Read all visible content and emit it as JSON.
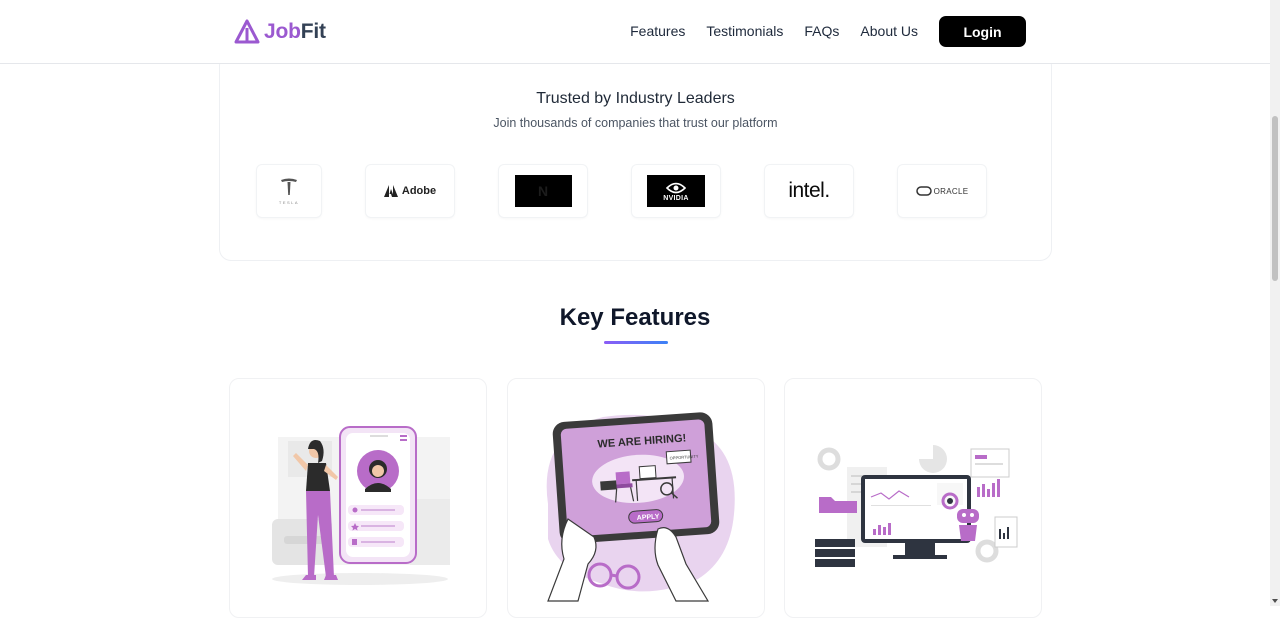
{
  "header": {
    "logo_part1": "Job",
    "logo_part2": "Fit",
    "nav": {
      "features": "Features",
      "testimonials": "Testimonials",
      "faqs": "FAQs",
      "about": "About Us"
    },
    "login_label": "Login"
  },
  "trusted": {
    "title": "Trusted by Industry Leaders",
    "subtitle": "Join thousands of companies that trust our platform",
    "logos": {
      "tesla": "TESLA",
      "adobe": "Adobe",
      "netflix": "N",
      "nvidia": "NVIDIA",
      "intel": "intel.",
      "oracle": "ORACLE"
    }
  },
  "features": {
    "title": "Key Features",
    "hiring_banner": "WE ARE HIRING!",
    "apply_label": "APPLY",
    "opportunity_tag": "OPPORTUNITY"
  },
  "colors": {
    "brand_purple": "#9b59d0",
    "illustration_purple": "#b86cc8",
    "dark": "#0f172a"
  }
}
